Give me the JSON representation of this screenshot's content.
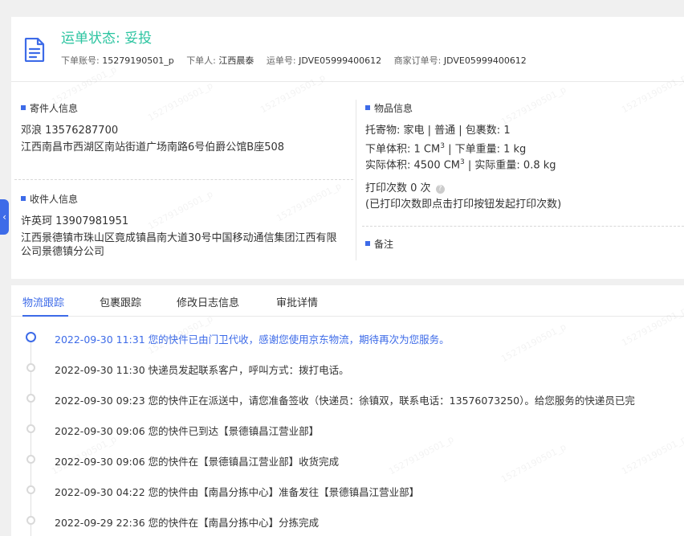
{
  "header": {
    "status": "运单状态: 妥投",
    "fields": [
      {
        "label": "下单账号:",
        "value": "15279190501_p"
      },
      {
        "label": "下单人:",
        "value": "江西晨泰"
      },
      {
        "label": "运单号:",
        "value": "JDVE05999400612"
      },
      {
        "label": "商家订单号:",
        "value": "JDVE05999400612"
      }
    ]
  },
  "sender": {
    "title": "寄件人信息",
    "name_phone": "邓浪   13576287700",
    "address": "江西南昌市西湖区南站街道广场南路6号伯爵公馆B座508"
  },
  "receiver": {
    "title": "收件人信息",
    "name_phone": "许英珂   13907981951",
    "address": "江西景德镇市珠山区竟成镇昌南大道30号中国移动通信集团江西有限公司景德镇分公司"
  },
  "goods": {
    "title": "物品信息",
    "line1": "托寄物:  家电 | 普通 | 包裹数:   1",
    "line2_a": "下单体积:    1 CM",
    "line2_b": "  |  下单重量:   1 kg",
    "line3_a": "实际体积:    4500 CM",
    "line3_b": "  |  实际重量:    0.8 kg",
    "sup": "3",
    "print_count": "打印次数   0 次",
    "print_hint": "(已打印次数即点击打印按钮发起打印次数)",
    "help_glyph": "?"
  },
  "remarks": {
    "title": "备注"
  },
  "side_tab": {
    "glyph": "‹"
  },
  "tabs": [
    "物流跟踪",
    "包裹跟踪",
    "修改日志信息",
    "审批详情"
  ],
  "timeline": [
    "2022-09-30 11:31 您的快件已由门卫代收，感谢您使用京东物流，期待再次为您服务。",
    "2022-09-30 11:30 快递员发起联系客户，呼叫方式：拨打电话。",
    "2022-09-30 09:23 您的快件正在派送中，请您准备签收（快递员：徐镇双，联系电话：13576073250）。给您服务的快递员已完",
    "2022-09-30 09:06 您的快件已到达【景德镇昌江营业部】",
    "2022-09-30 09:06 您的快件在【景德镇昌江营业部】收货完成",
    "2022-09-30 04:22 您的快件由【南昌分拣中心】准备发往【景德镇昌江营业部】",
    "2022-09-29 22:36 您的快件在【南昌分拣中心】分拣完成"
  ],
  "watermark": "15279190501_p",
  "colors": {
    "accent": "#3d6be8",
    "status": "#2bc4a0"
  }
}
